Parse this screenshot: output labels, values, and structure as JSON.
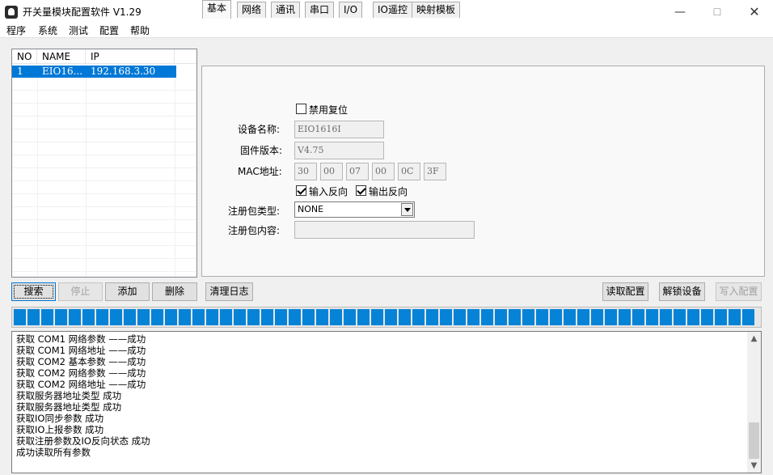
{
  "window": {
    "title": "开关量模块配置软件 V1.29",
    "min_symbol": "—",
    "max_symbol": "☐",
    "close_symbol": "✕"
  },
  "menu": [
    "程序",
    "系统",
    "测试",
    "配置",
    "帮助"
  ],
  "device_list": {
    "headers": [
      "NO",
      "NAME",
      "IP"
    ],
    "rows": [
      {
        "no": "1",
        "name": "EIO16...",
        "ip": "192.168.3.30",
        "selected": true
      }
    ]
  },
  "tabs": [
    {
      "label": "基本",
      "active": true
    },
    {
      "label": "网络",
      "active": false
    },
    {
      "label": "通讯",
      "active": false
    },
    {
      "label": "串口",
      "active": false
    },
    {
      "label": "I/O",
      "active": false
    },
    {
      "label": "IO遥控",
      "active": false
    },
    {
      "label": "映射模板",
      "active": false
    }
  ],
  "basic": {
    "disable_reset_label": "禁用复位",
    "disable_reset_checked": false,
    "device_name_label": "设备名称:",
    "device_name_value": "EIO1616I",
    "firmware_label": "固件版本:",
    "firmware_value": "V4.75",
    "mac_label": "MAC地址:",
    "mac_values": [
      "30",
      "00",
      "07",
      "00",
      "0C",
      "3F"
    ],
    "input_invert_label": "输入反向",
    "input_invert_checked": true,
    "output_invert_label": "输出反向",
    "output_invert_checked": true,
    "reg_type_label": "注册包类型:",
    "reg_type_value": "NONE",
    "reg_content_label": "注册包内容:",
    "reg_content_value": ""
  },
  "buttons": {
    "search": "搜索",
    "stop": "停止",
    "add": "添加",
    "delete": "删除",
    "clear_log": "清理日志",
    "read_config": "读取配置",
    "unlock_device": "解锁设备",
    "write_config": "写入配置"
  },
  "progress": {
    "value_fraction": 1.0
  },
  "log_lines": [
    "获取  COM1 网络参数 ——成功",
    "获取  COM1 网络地址 ——成功",
    "获取  COM2 基本参数 ——成功",
    "获取  COM2 网络参数 ——成功",
    "获取  COM2 网络地址 ——成功",
    "获取服务器地址类型 成功",
    "获取服务器地址类型 成功",
    "获取IO同步参数 成功",
    "获取IO上报参数 成功",
    "获取注册参数及IO反向状态 成功",
    "成功读取所有参数"
  ],
  "scroll_icons": {
    "up": "▲",
    "down": "▼"
  },
  "colors": {
    "accent": "#0078d7",
    "progress": "#0683d7"
  }
}
